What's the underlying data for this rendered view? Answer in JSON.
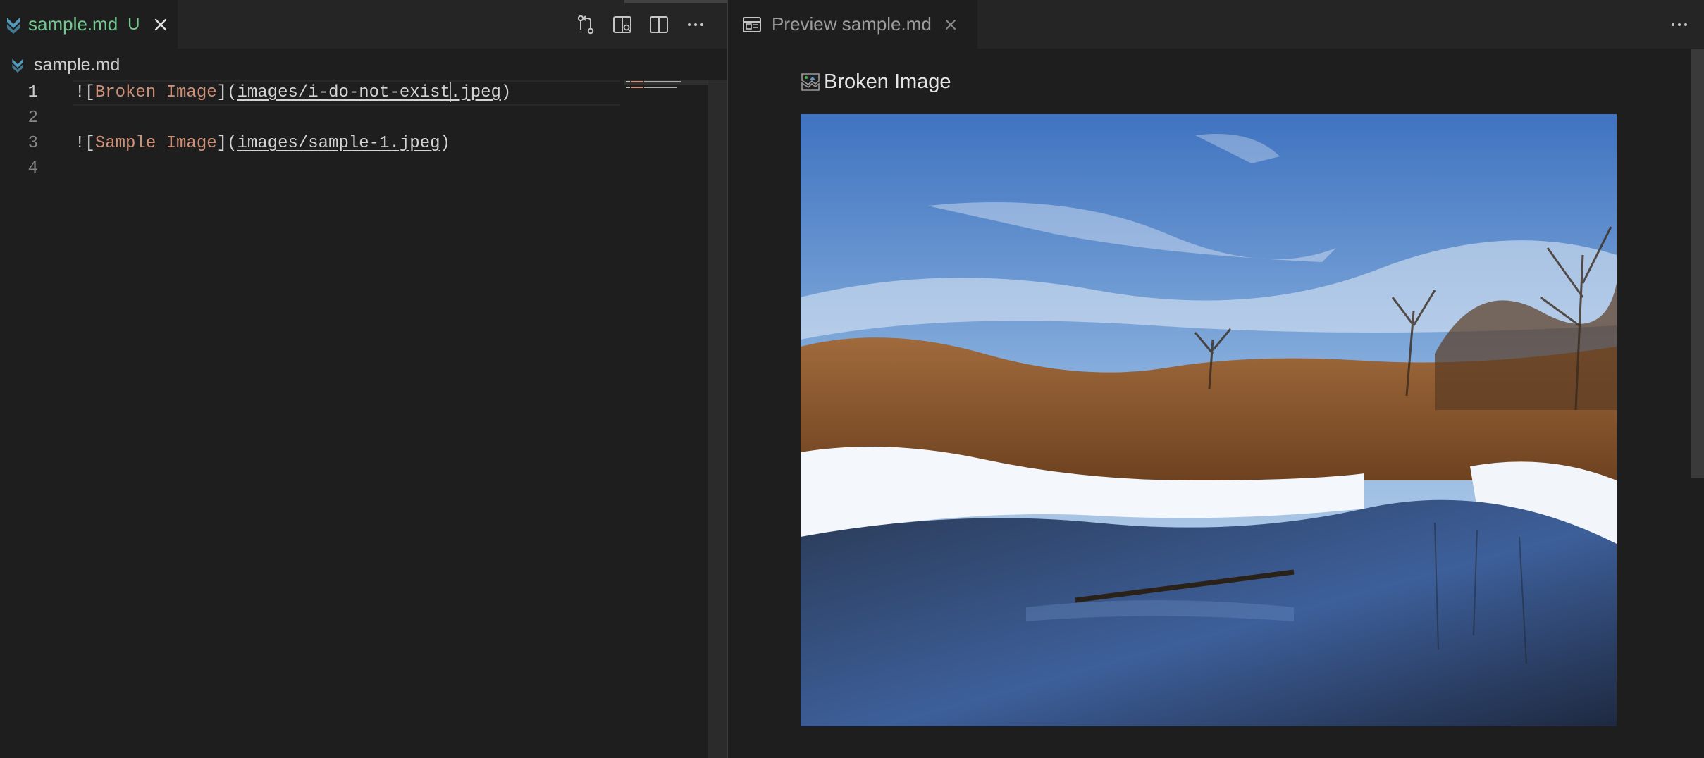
{
  "editor": {
    "tab": {
      "title": "sample.md",
      "status": "U",
      "icon": "markdown-icon"
    },
    "actions": [
      "open-changes-icon",
      "open-preview-to-side-icon",
      "split-editor-icon",
      "more-actions-icon"
    ],
    "breadcrumb": {
      "label": "sample.md",
      "icon": "markdown-icon"
    },
    "lines": [
      {
        "number": "1",
        "prefix": "![",
        "alt": "Broken Image",
        "mid": "](",
        "url_before_cursor": "images/i-do-not-exist",
        "url_after_cursor": ".jpeg",
        "suffix": ")"
      },
      {
        "number": "2"
      },
      {
        "number": "3",
        "prefix": "![",
        "alt": "Sample Image",
        "mid": "](",
        "url": "images/sample-1.jpeg",
        "suffix": ")"
      },
      {
        "number": "4"
      }
    ]
  },
  "preview": {
    "tab": {
      "title": "Preview sample.md",
      "icon": "preview-icon"
    },
    "broken_image_alt": "Broken Image",
    "image_alt": "Sample Image",
    "more_icon": "more-actions-icon"
  },
  "colors": {
    "background": "#1e1e1e",
    "tab_bar": "#252526",
    "untracked_green": "#73c991",
    "string_orange": "#ce9178",
    "markdown_blue": "#519aba"
  }
}
